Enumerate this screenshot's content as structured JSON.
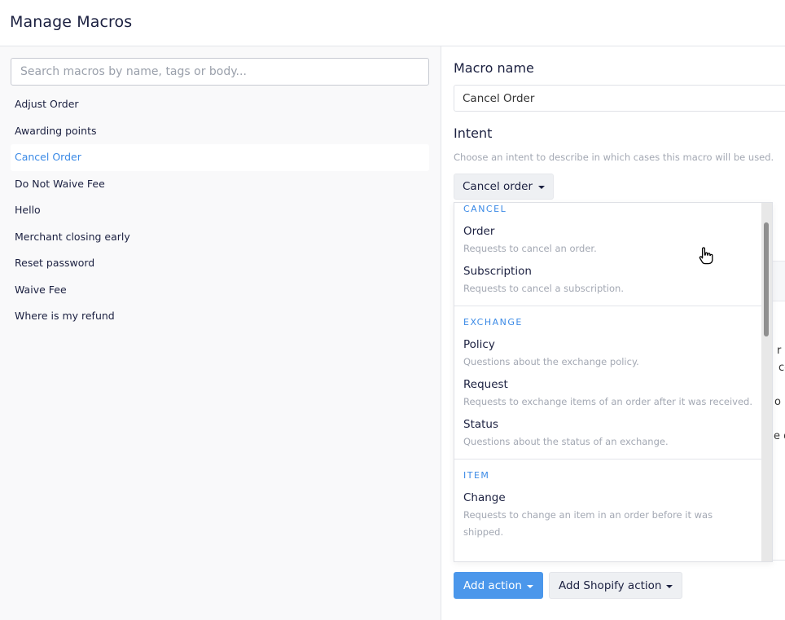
{
  "header": {
    "title": "Manage Macros"
  },
  "search": {
    "placeholder": "Search macros by name, tags or body..."
  },
  "macros": [
    {
      "label": "Adjust Order"
    },
    {
      "label": "Awarding points"
    },
    {
      "label": "Cancel Order"
    },
    {
      "label": "Do Not Waive Fee"
    },
    {
      "label": "Hello"
    },
    {
      "label": "Merchant closing early"
    },
    {
      "label": "Reset password"
    },
    {
      "label": "Waive Fee"
    },
    {
      "label": "Where is my refund"
    }
  ],
  "selected_macro": "Cancel Order",
  "form": {
    "macro_name_label": "Macro name",
    "macro_name_value": "Cancel Order",
    "intent_label": "Intent",
    "intent_helper": "Choose an intent to describe in which cases this macro will be used.",
    "intent_value": "Cancel order"
  },
  "intent_menu": {
    "groups": [
      {
        "header": "CANCEL",
        "items": [
          {
            "title": "Order",
            "desc": "Requests to cancel an order."
          },
          {
            "title": "Subscription",
            "desc": "Requests to cancel a subscription."
          }
        ]
      },
      {
        "header": "EXCHANGE",
        "items": [
          {
            "title": "Policy",
            "desc": "Questions about the exchange policy."
          },
          {
            "title": "Request",
            "desc": "Requests to exchange items of an order after it was received."
          },
          {
            "title": "Status",
            "desc": "Questions about the status of an exchange."
          }
        ]
      },
      {
        "header": "ITEM",
        "items": [
          {
            "title": "Change",
            "desc": "Requests to change an item in an order before it was shipped."
          }
        ]
      }
    ]
  },
  "background_fragments": [
    {
      "text": "r re"
    },
    {
      "text": "co"
    },
    {
      "text": "o n"
    },
    {
      "text": "e de"
    }
  ],
  "actions": {
    "add_action": "Add action",
    "add_shopify_action": "Add Shopify action"
  },
  "colors": {
    "accent": "#3b8ae6",
    "primary_button": "#4b97eb",
    "text": "#1b2040",
    "muted": "#a3a8b3"
  },
  "icons": {
    "cursor": "hand-pointer-icon",
    "dropdown": "caret-down-icon"
  }
}
